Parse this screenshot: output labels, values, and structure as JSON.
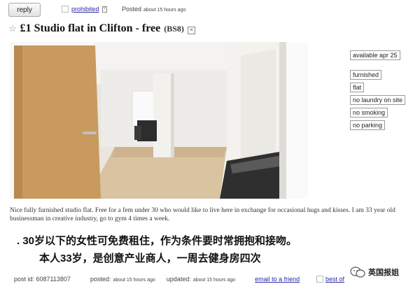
{
  "toolbar": {
    "reply_label": "reply",
    "prohibited_label": "prohibited",
    "posted_label": "Posted",
    "posted_time": "about 15 hours ago"
  },
  "posting": {
    "title": "£1 Studio flat in Clifton - free",
    "location": "(BS8)",
    "attributes_top": [
      "available apr 25"
    ],
    "attributes": [
      "furnished",
      "flat",
      "no laundry on site",
      "no smoking",
      "no parking"
    ],
    "body": "Nice fully furnished studio flat. Free for a fem under 30 who would like to live here in exchange for occasional hugs and kisses. I am 33 year old businessman in creative industry, go to gym 4 times a week.",
    "caption_line1": ". 30岁以下的女性可免费租住，作为条件要时常拥抱和接吻。",
    "caption_line2": "本人33岁，是创意产业商人，一周去健身房四次"
  },
  "footer": {
    "post_id": "post id: 6087113807",
    "posted_label": "posted:",
    "posted_time": "about 15 hours ago",
    "updated_label": "updated:",
    "updated_time": "about 15 hours ago",
    "email_label": "email to a friend",
    "best_of_label": "best of"
  },
  "watermark": {
    "text": "英国报姐"
  },
  "icons": [
    "star-icon",
    "delete-icon",
    "checkbox-icon",
    "info-icon",
    "watermark-logo-icon"
  ]
}
